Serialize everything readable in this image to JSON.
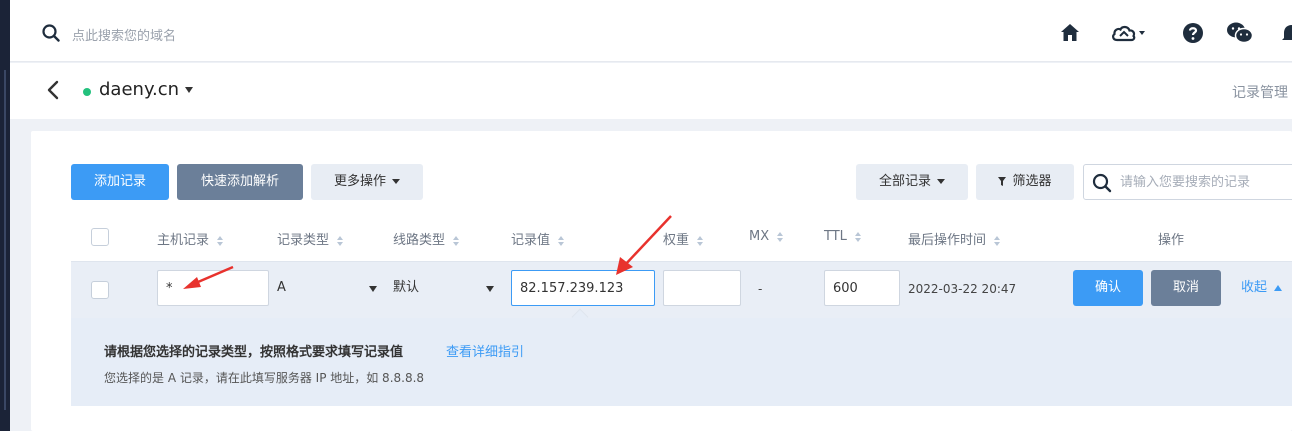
{
  "topbar": {
    "search_placeholder": "点此搜索您的域名",
    "icons": [
      "home-icon",
      "cloud-icon",
      "help-icon",
      "wechat-icon",
      "bell-icon"
    ]
  },
  "domain": {
    "name": "daeny.cn",
    "status_color": "#23c17d",
    "right_link": "记录管理"
  },
  "toolbar": {
    "add_record": "添加记录",
    "quick_add": "快速添加解析",
    "more_actions": "更多操作",
    "all_records": "全部记录",
    "filter": "筛选器",
    "search_placeholder": "请输入您要搜索的记录"
  },
  "table": {
    "headers": {
      "host": "主机记录",
      "type": "记录类型",
      "line": "线路类型",
      "value": "记录值",
      "weight": "权重",
      "mx": "MX",
      "ttl": "TTL",
      "updated": "最后操作时间",
      "actions": "操作"
    },
    "edit_row": {
      "host": "*",
      "type": "A",
      "line": "默认",
      "value": "82.157.239.123",
      "weight": "",
      "mx": "-",
      "ttl": "600",
      "updated": "2022-03-22 20:47",
      "confirm": "确认",
      "cancel": "取消",
      "collapse": "收起"
    }
  },
  "hint": {
    "title": "请根据您选择的记录类型，按照格式要求填写记录值",
    "link": "查看详细指引",
    "detail": "您选择的是 A 记录，请在此填写服务器 IP 地址，如 8.8.8.8"
  },
  "colors": {
    "primary": "#3c9bf5",
    "secondary": "#6b7f99",
    "annotation_arrow": "#e8322d"
  }
}
